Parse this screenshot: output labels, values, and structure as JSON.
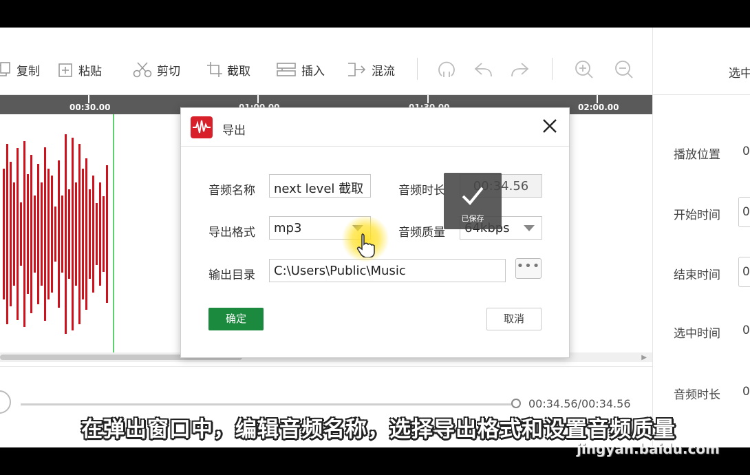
{
  "toolbar": {
    "items": [
      {
        "label": "复制",
        "icon": "copy-icon"
      },
      {
        "label": "粘贴",
        "icon": "paste-icon"
      },
      {
        "label": "剪切",
        "icon": "scissors-icon"
      },
      {
        "label": "截取",
        "icon": "crop-icon"
      },
      {
        "label": "插入",
        "icon": "insert-icon"
      },
      {
        "label": "混流",
        "icon": "mix-icon"
      }
    ],
    "icon_buttons": [
      "loop-icon",
      "undo-icon",
      "redo-icon",
      "zoom-in-icon",
      "zoom-out-icon"
    ]
  },
  "timeline": {
    "ticks": [
      "00:30.00",
      "01:00.00",
      "01:30.00",
      "02:00.00"
    ]
  },
  "right_panel": {
    "header": "选中",
    "rows": [
      {
        "label": "播放位置",
        "value": "0"
      },
      {
        "label": "开始时间",
        "value": "0"
      },
      {
        "label": "结束时间",
        "value": "0"
      },
      {
        "label": "选中时间",
        "value": "0"
      },
      {
        "label": "音频时长",
        "value": "0"
      }
    ]
  },
  "transport": {
    "time": "00:34.56/00:34.56",
    "progress": 1.0
  },
  "dialog": {
    "title": "导出",
    "name_label": "音频名称",
    "name_value": "next level 截取",
    "duration_label": "音频时长",
    "duration_value": "00:34.56",
    "format_label": "导出格式",
    "format_value": "mp3",
    "quality_label": "音频质量",
    "quality_value": "64kbps",
    "dir_label": "输出目录",
    "dir_value": "C:\\Users\\Public\\Music",
    "more_label": "•••",
    "ok_label": "确定",
    "cancel_label": "取消"
  },
  "toast": {
    "text": "已保存"
  },
  "caption": "在弹出窗口中，编辑音频名称，选择导出格式和设置音频质量",
  "watermark": "jingyan.baidu.com",
  "colors": {
    "waveform": "#d0101a",
    "playhead": "#5cd16a",
    "ok_button": "#1b8a3e",
    "logo": "#d8202a"
  }
}
